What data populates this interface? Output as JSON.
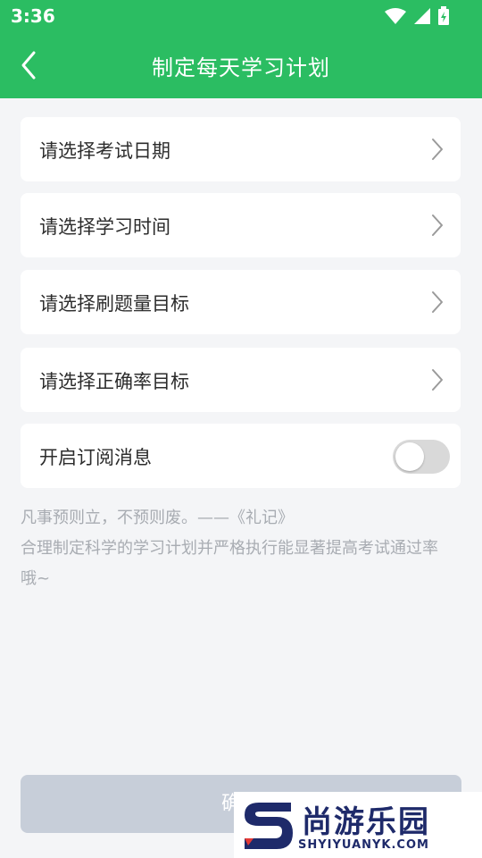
{
  "status_bar": {
    "time": "3:36",
    "icons": [
      "wifi-icon",
      "signal-icon",
      "battery-icon"
    ]
  },
  "header": {
    "title": "制定每天学习计划",
    "back_icon": "chevron-left-icon",
    "background_color": "#2bbd62"
  },
  "settings": [
    {
      "label": "请选择考试日期",
      "icon": "chevron-right-icon"
    },
    {
      "label": "请选择学习时间",
      "icon": "chevron-right-icon"
    },
    {
      "label": "请选择刷题量目标",
      "icon": "chevron-right-icon"
    },
    {
      "label": "请选择正确率目标",
      "icon": "chevron-right-icon"
    }
  ],
  "subscription": {
    "label": "开启订阅消息",
    "enabled": false
  },
  "quote": {
    "line1": "凡事预则立，不预则废。——《礼记》",
    "line2": "合理制定科学的学习计划并严格执行能显著提高考试通过率哦~"
  },
  "confirm_button": {
    "label": "确认",
    "color": "#c7ced9"
  },
  "watermark": {
    "name": "尚游乐园",
    "url": "SHYIYUANYK.COM"
  }
}
